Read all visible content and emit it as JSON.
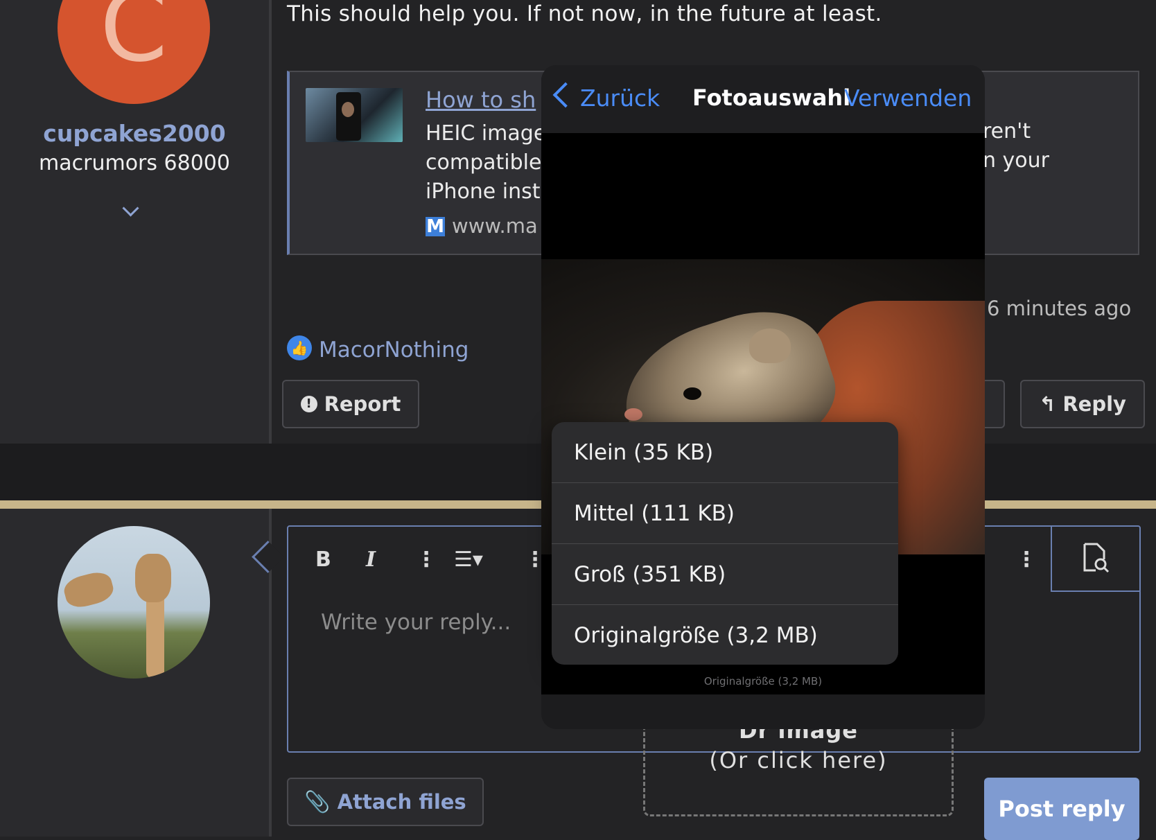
{
  "post": {
    "author": {
      "initial": "C",
      "username": "cupcakes2000",
      "title": "macrumors 68000"
    },
    "message": "This should help you. If not now, in the future at least.",
    "link_preview": {
      "title": "How to sh",
      "desc_line1": "HEIC image",
      "desc_line2": "compatible",
      "desc_line3": "iPhone inst",
      "right_line1": "ren't",
      "right_line2": "n your",
      "site_letter": "M",
      "site": "www.ma"
    },
    "timestamp": "6 minutes ago",
    "liked_by": "MacorNothing",
    "report_label": "Report",
    "reply_label": "Reply"
  },
  "reply_form": {
    "toolbar": {
      "bold": "B",
      "italic": "I",
      "more": "⋮",
      "list": "☰▾"
    },
    "placeholder": "Write your reply...",
    "attach_label": "Attach files",
    "drop_label": "Dr   image",
    "drop_sub": "(Or click here)",
    "post_label": "Post reply"
  },
  "picker": {
    "back_label": "Zurück",
    "title": "Fotoauswahl",
    "use_label": "Verwenden",
    "sizes": [
      "Klein (35 KB)",
      "Mittel (111 KB)",
      "Groß (351 KB)",
      "Originalgröße (3,2 MB)"
    ],
    "footer": "Originalgröße (3,2 MB)"
  },
  "colors": {
    "accent_blue": "#8fa4d3",
    "ios_blue": "#4a8cf7",
    "avatar_orange": "#d5542e",
    "gold_line": "#c7b58a",
    "post_button": "#7f9bd1"
  }
}
